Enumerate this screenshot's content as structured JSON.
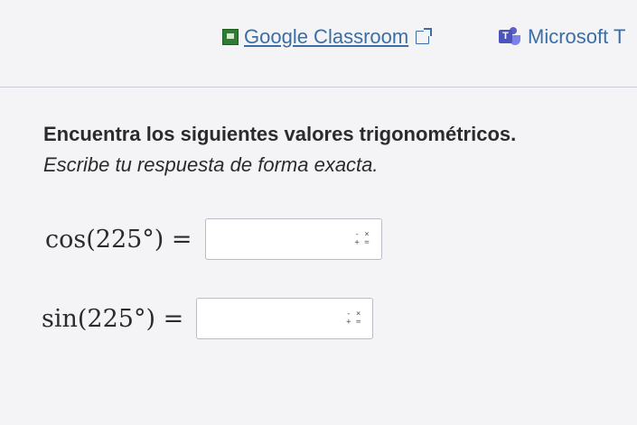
{
  "linkbar": {
    "classroom_label": "Google Classroom",
    "microsoft_label": "Microsoft T"
  },
  "instructions": {
    "line1": "Encuentra los siguientes valores trigonométricos.",
    "line2": "Escribe tu respuesta de forma exacta."
  },
  "equations": [
    {
      "expression": "cos(225°) =",
      "value": ""
    },
    {
      "expression": "sin(225°) =",
      "value": ""
    }
  ],
  "keypad_icon": {
    "top": "- ×",
    "bottom": "+ ="
  },
  "colors": {
    "link": "#3a6ea5",
    "classroom_green": "#2e7d32",
    "teams_purple": "#4b53bc"
  }
}
